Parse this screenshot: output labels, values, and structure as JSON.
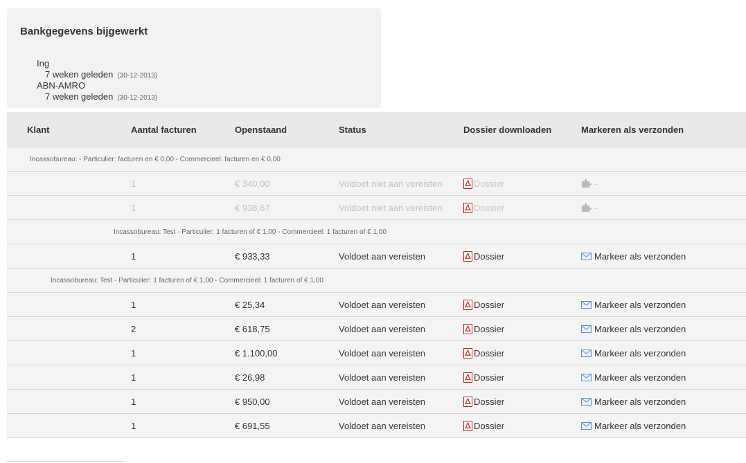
{
  "panel": {
    "title": "Bankgegevens bijgewerkt",
    "banks": [
      {
        "name": "Ing",
        "ago": "7 weken geleden",
        "date": "(30-12-2013)"
      },
      {
        "name": "ABN-AMRO",
        "ago": "7 weken geleden",
        "date": "(30-12-2013)"
      }
    ]
  },
  "table": {
    "headers": [
      "Klant",
      "Aantal facturen",
      "Openstaand",
      "Status",
      "Dossier downloaden",
      "Markeren als verzonden"
    ],
    "dossier_label": "Dossier",
    "mark_label": "Markeer als verzonden",
    "dash_label": "-",
    "groups": [
      {
        "label": "Incassobureau: - Particulier: facturen en € 0,00 - Commercieel: facturen en € 0,00",
        "rows": [
          {
            "aantal": "1",
            "openstaand": "€ 340,00",
            "status": "Voldoet niet aan vereisten"
          },
          {
            "aantal": "1",
            "openstaand": "€ 938,67",
            "status": "Voldoet niet aan vereisten"
          }
        ]
      },
      {
        "label": "Incassobureau: Test - Particulier: 1 facturen of € 1,00 - Commercieel: 1 facturen of € 1,00",
        "rows": [
          {
            "aantal": "1",
            "openstaand": "€ 933,33",
            "status": "Voldoet aan vereisten"
          }
        ]
      },
      {
        "label": "Incassobureau: Test - Particulier: 1 facturen of € 1,00 - Commercieel: 1 facturen of € 1,00",
        "rows": [
          {
            "aantal": "1",
            "openstaand": "€ 25,34",
            "status": "Voldoet aan vereisten"
          },
          {
            "aantal": "2",
            "openstaand": "€ 618,75",
            "status": "Voldoet aan vereisten"
          },
          {
            "aantal": "1",
            "openstaand": "€ 1.100,00",
            "status": "Voldoet aan vereisten"
          },
          {
            "aantal": "1",
            "openstaand": "€ 26,98",
            "status": "Voldoet aan vereisten"
          },
          {
            "aantal": "1",
            "openstaand": "€ 950,00",
            "status": "Voldoet aan vereisten"
          },
          {
            "aantal": "1",
            "openstaand": "€ 691,55",
            "status": "Voldoet aan vereisten"
          }
        ]
      }
    ]
  },
  "colors": {
    "panel_bg": "#f2f2f2",
    "header_bg": "#e9e9e9",
    "row_bg": "#f4f4f4",
    "disabled_text": "#c2c2c2",
    "pdf_red": "#d0221b",
    "mail_blue": "#5a8fc6"
  },
  "icons": [
    "pdf-icon",
    "mail-icon",
    "puzzle-icon"
  ]
}
